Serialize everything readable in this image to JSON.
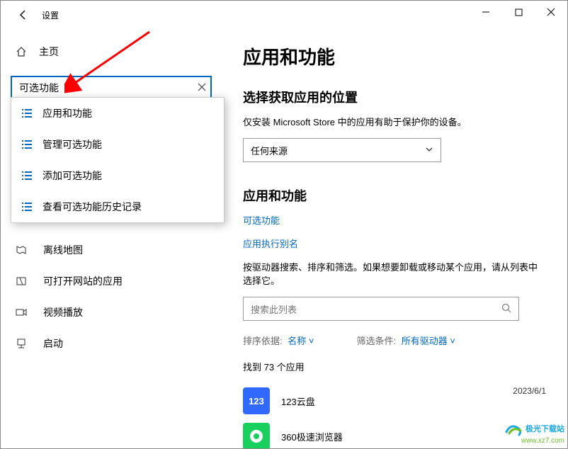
{
  "window": {
    "title": "设置"
  },
  "sidebar": {
    "home": "主页",
    "search_value": "可选功能",
    "suggestions": [
      "应用和功能",
      "管理可选功能",
      "添加可选功能",
      "查看可选功能历史记录"
    ],
    "nav": [
      {
        "label": "离线地图"
      },
      {
        "label": "可打开网站的应用"
      },
      {
        "label": "视频播放"
      },
      {
        "label": "启动"
      }
    ]
  },
  "content": {
    "h1": "应用和功能",
    "section1_title": "选择获取应用的位置",
    "section1_desc": "仅安装 Microsoft Store 中的应用有助于保护你的设备。",
    "source_select": "任何来源",
    "section2_title": "应用和功能",
    "link1": "可选功能",
    "link2": "应用执行别名",
    "search_desc": "按驱动器搜索、排序和筛选。如果想要卸载或移动某个应用，请从列表中选择它。",
    "search_placeholder": "搜索此列表",
    "sort_label": "排序依据:",
    "sort_value": "名称",
    "filter_label": "筛选条件:",
    "filter_value": "所有驱动器",
    "found_text": "找到 73 个应用",
    "apps": [
      {
        "name": "123云盘",
        "date": "2023/6/1",
        "icon_text": "123",
        "icon_bg": "#3169ff"
      },
      {
        "name": "360极速浏览器",
        "date": "",
        "icon_text": "",
        "icon_bg": "#17d05e"
      }
    ]
  },
  "watermark": {
    "line1": "极光下载站",
    "line2": "www.xz7.com"
  }
}
